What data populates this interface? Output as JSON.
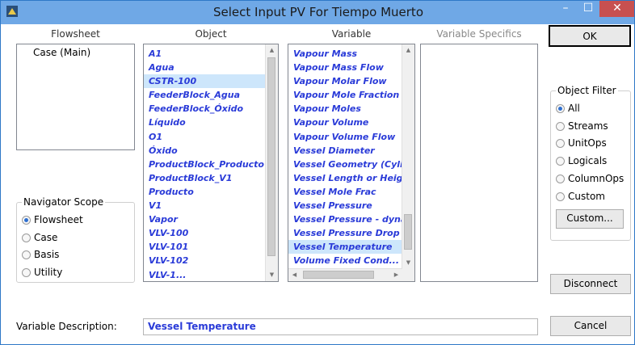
{
  "window": {
    "title": "Select Input PV For Tiempo Muerto"
  },
  "titlebar": {
    "minimize": "–",
    "maximize": "☐",
    "close": "✕"
  },
  "columns": {
    "flowsheet": "Flowsheet",
    "object": "Object",
    "variable": "Variable",
    "specifics": "Variable Specifics"
  },
  "flowsheet_list": {
    "items": [
      "Case (Main)"
    ]
  },
  "object_list": {
    "items": [
      "A1",
      "Agua",
      "CSTR-100",
      "FeederBlock_Agua",
      "FeederBlock_Óxido",
      "Líquido",
      "O1",
      "Óxido",
      "ProductBlock_Producto",
      "ProductBlock_V1",
      "Producto",
      "V1",
      "Vapor",
      "VLV-100",
      "VLV-101",
      "VLV-102",
      "VLV-1..."
    ],
    "selected": "CSTR-100"
  },
  "variable_list": {
    "items": [
      "Vapour Mass",
      "Vapour Mass Flow",
      "Vapour Molar Flow",
      "Vapour Mole Fraction",
      "Vapour Moles",
      "Vapour Volume",
      "Vapour Volume Flow",
      "Vessel Diameter",
      "Vessel Geometry (Cylindri",
      "Vessel Length or Height",
      "Vessel Mole Frac",
      "Vessel Pressure",
      "Vessel Pressure - dynamic",
      "Vessel Pressure Drop",
      "Vessel Temperature",
      "Volume Fixed Cond..."
    ],
    "selected": "Vessel Temperature"
  },
  "navigator_scope": {
    "label": "Navigator Scope",
    "options": [
      "Flowsheet",
      "Case",
      "Basis",
      "Utility"
    ],
    "selected": "Flowsheet"
  },
  "object_filter": {
    "label": "Object Filter",
    "options": [
      "All",
      "Streams",
      "UnitOps",
      "Logicals",
      "ColumnOps",
      "Custom"
    ],
    "selected": "All"
  },
  "buttons": {
    "ok": "OK",
    "custom": "Custom...",
    "disconnect": "Disconnect",
    "cancel": "Cancel"
  },
  "description": {
    "label": "Variable Description:",
    "value": "Vessel Temperature"
  },
  "colors": {
    "titlebar": "#6fa8e6",
    "item_text": "#2a3bd8",
    "selection": "#cde6fb",
    "close": "#c75050"
  }
}
